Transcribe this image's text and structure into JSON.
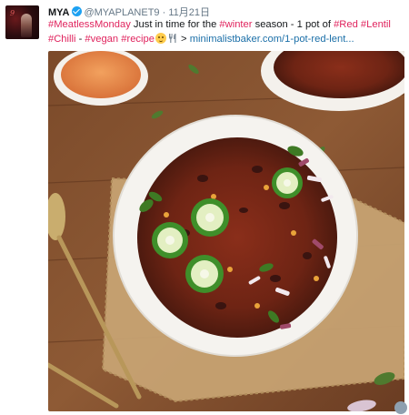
{
  "tweet": {
    "author_name": "MYA",
    "handle": "@MYAPLANET9",
    "separator": "·",
    "date": "11月21日",
    "text": {
      "hashtag_meatless": "#MeatlessMonday",
      "text_1": " Just in time for the ",
      "hashtag_winter": "#winter",
      "text_2": " season - 1 pot of ",
      "hashtag_red": "#Red",
      "text_3": " ",
      "hashtag_lentil": "#Lentil",
      "hashtag_chilli": "#Chilli",
      "text_4": " - ",
      "hashtag_vegan": "#vegan",
      "text_5": " ",
      "hashtag_recipe": "#recipe",
      "text_6": " > ",
      "link": "minimalistbaker.com/1-pot-red-lent..."
    }
  },
  "icons": {
    "verified": "verified-badge-icon",
    "emoji": "yum-face-emoji-icon",
    "utensils": "fork-knife-icon"
  },
  "colors": {
    "hashtag": "#e0245e",
    "link": "#1b6fa8",
    "verified": "#1da1f2"
  },
  "media": {
    "alt": "",
    "subject": "bowl of red lentil chilli with jalapeño slices, cilantro and onion on a wooden table"
  }
}
